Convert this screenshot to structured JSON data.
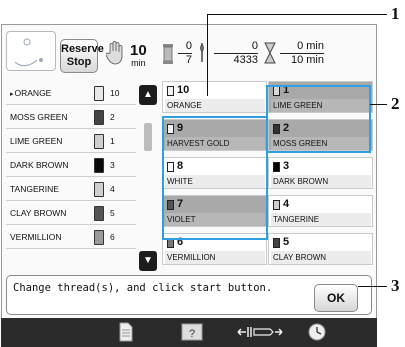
{
  "header": {
    "reserve_stop_line1": "Reserve",
    "reserve_stop_line2": "Stop",
    "stitch_time_value": "10",
    "stitch_time_unit": "min",
    "color_current": "0",
    "color_total": "7",
    "stitch_current": "0",
    "stitch_total": "4333",
    "time_current": "0 min",
    "time_total": "10 min"
  },
  "left_list": [
    {
      "name": "ORANGE",
      "num": "10",
      "spool_color": "#e8e8e8",
      "active": true
    },
    {
      "name": "MOSS GREEN",
      "num": "2",
      "spool_color": "#444444"
    },
    {
      "name": "LIME GREEN",
      "num": "1",
      "spool_color": "#cfcfcf"
    },
    {
      "name": "DARK BROWN",
      "num": "3",
      "spool_color": "#0a0a0a"
    },
    {
      "name": "TANGERINE",
      "num": "4",
      "spool_color": "#cfcfcf"
    },
    {
      "name": "CLAY BROWN",
      "num": "5",
      "spool_color": "#555555"
    },
    {
      "name": "VERMILLION",
      "num": "6",
      "spool_color": "#9a9a9a"
    }
  ],
  "grid": [
    {
      "num": "10",
      "name": "ORANGE",
      "dim": false,
      "swatch": "#f2f2f2"
    },
    {
      "num": "1",
      "name": "LIME GREEN",
      "dim": true,
      "swatch": "#d8d8d8"
    },
    {
      "num": "9",
      "name": "HARVEST GOLD",
      "dim": true,
      "swatch": "#f2f2f2"
    },
    {
      "num": "2",
      "name": "MOSS GREEN",
      "dim": true,
      "swatch": "#333333"
    },
    {
      "num": "8",
      "name": "WHITE",
      "dim": false,
      "swatch": "#ffffff"
    },
    {
      "num": "3",
      "name": "DARK BROWN",
      "dim": false,
      "swatch": "#000000"
    },
    {
      "num": "7",
      "name": "VIOLET",
      "dim": true,
      "swatch": "#555555"
    },
    {
      "num": "4",
      "name": "TANGERINE",
      "dim": false,
      "swatch": "#cfcfcf"
    },
    {
      "num": "6",
      "name": "VERMILLION",
      "dim": false,
      "swatch": "#777777"
    },
    {
      "num": "5",
      "name": "CLAY BROWN",
      "dim": false,
      "swatch": "#444444"
    }
  ],
  "message": {
    "text": "Change thread(s), and click start button.",
    "ok_label": "OK"
  },
  "callouts": {
    "c1": "1",
    "c2": "2",
    "c3": "3"
  },
  "colors": {
    "highlight": "#2e9fe0",
    "bottom_bar": "#2b2b2b"
  }
}
